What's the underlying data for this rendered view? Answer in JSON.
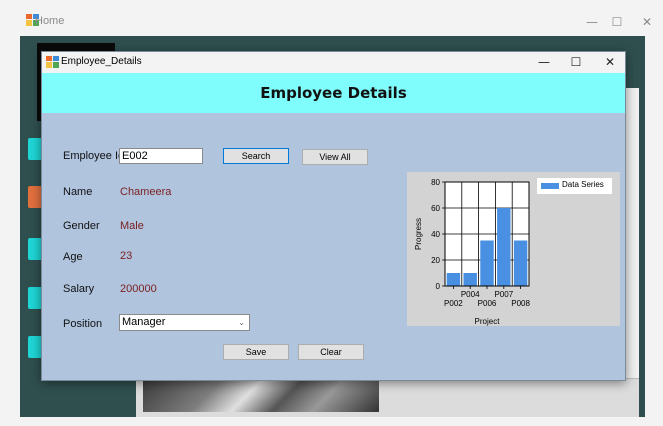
{
  "home_window": {
    "title": "Home",
    "minimize_glyph": "—",
    "maximize_glyph": "☐",
    "close_glyph": "✕"
  },
  "dialog": {
    "title": "Employee_Details",
    "minimize_glyph": "—",
    "maximize_glyph": "☐",
    "close_glyph": "✕",
    "header": "Employee Details"
  },
  "form": {
    "employee_id_label": "Employee Id",
    "employee_id_value": "E002",
    "search_label": "Search",
    "view_all_label": "View All",
    "name_label": "Name",
    "name_value": "Chameera",
    "gender_label": "Gender",
    "gender_value": "Male",
    "age_label": "Age",
    "age_value": "23",
    "salary_label": "Salary",
    "salary_value": "200000",
    "position_label": "Position",
    "position_value": "Manager",
    "save_label": "Save",
    "clear_label": "Clear"
  },
  "colors": {
    "accent_header": "#7ffcfc",
    "dialog_bg": "#b0c4de",
    "value_text": "#7a1f1f",
    "bar": "#4a90e2",
    "chart_bg": "#d3d3d3"
  },
  "chart_data": {
    "type": "bar",
    "categories": [
      "P002",
      "P004",
      "P006",
      "P007",
      "P008"
    ],
    "series": [
      {
        "name": "Data Series",
        "values": [
          10,
          10,
          35,
          60,
          35
        ]
      }
    ],
    "title": "",
    "xlabel": "Project",
    "ylabel": "Progress",
    "ylim": [
      0,
      80
    ],
    "yticks": [
      0,
      20,
      40,
      60,
      80
    ],
    "grid": true,
    "legend": "top-right"
  }
}
